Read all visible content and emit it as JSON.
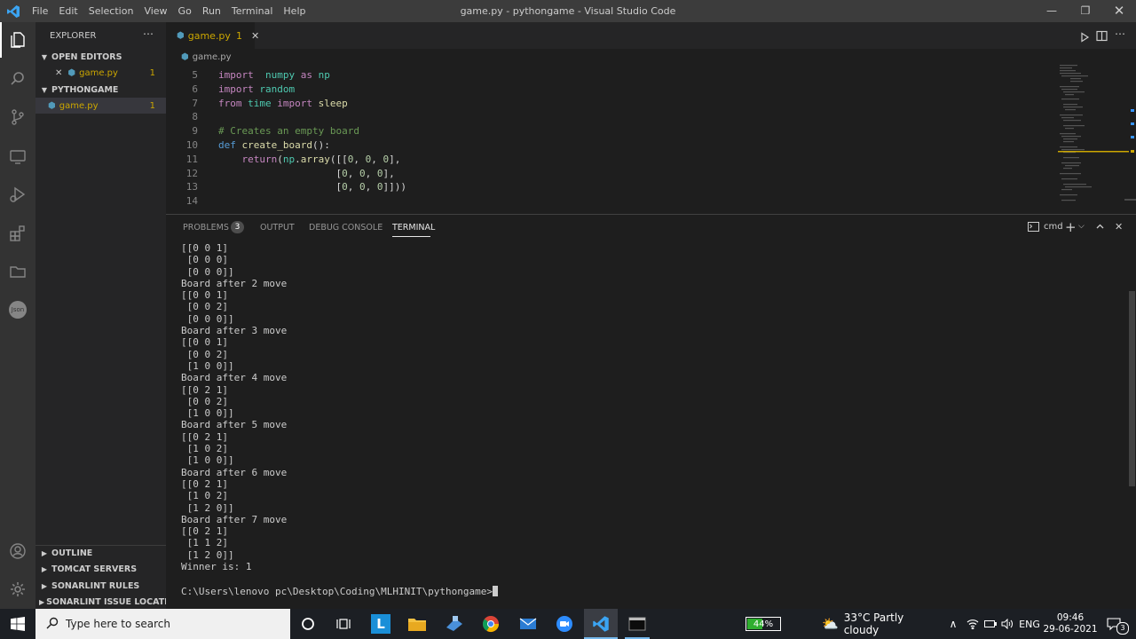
{
  "titlebar": {
    "menu": [
      "File",
      "Edit",
      "Selection",
      "View",
      "Go",
      "Run",
      "Terminal",
      "Help"
    ],
    "title": "game.py - pythongame - Visual Studio Code"
  },
  "sidebar": {
    "header": "EXPLORER",
    "open_editors": "OPEN EDITORS",
    "open_file": "game.py",
    "open_file_badge": "1",
    "project": "PYTHONGAME",
    "project_file": "game.py",
    "project_file_badge": "1",
    "bottom_sections": [
      "OUTLINE",
      "TOMCAT SERVERS",
      "SONARLINT RULES",
      "SONARLINT ISSUE LOCATIO..."
    ]
  },
  "editor": {
    "tab_label": "game.py",
    "tab_badge": "1",
    "breadcrumb": "game.py",
    "lines": [
      {
        "n": "5",
        "parts": [
          [
            "kw2",
            "import"
          ],
          [
            "",
            "  "
          ],
          [
            "mod",
            "numpy"
          ],
          [
            "",
            " "
          ],
          [
            "kw2",
            "as"
          ],
          [
            "",
            " "
          ],
          [
            "mod",
            "np"
          ]
        ]
      },
      {
        "n": "6",
        "parts": [
          [
            "kw2",
            "import"
          ],
          [
            "",
            " "
          ],
          [
            "mod",
            "random"
          ]
        ]
      },
      {
        "n": "7",
        "parts": [
          [
            "kw2",
            "from"
          ],
          [
            "",
            " "
          ],
          [
            "mod",
            "time"
          ],
          [
            "",
            " "
          ],
          [
            "kw2",
            "import"
          ],
          [
            "",
            " "
          ],
          [
            "fn",
            "sleep"
          ]
        ]
      },
      {
        "n": "8",
        "parts": []
      },
      {
        "n": "9",
        "parts": [
          [
            "cm",
            "# Creates an empty board"
          ]
        ]
      },
      {
        "n": "10",
        "parts": [
          [
            "kw",
            "def"
          ],
          [
            "",
            " "
          ],
          [
            "fn",
            "create_board"
          ],
          [
            "",
            "():"
          ]
        ]
      },
      {
        "n": "11",
        "parts": [
          [
            "",
            "    "
          ],
          [
            "kw2",
            "return"
          ],
          [
            "",
            "("
          ],
          [
            "mod",
            "np"
          ],
          [
            "",
            "."
          ],
          [
            "fn",
            "array"
          ],
          [
            "",
            "([["
          ],
          [
            "num",
            "0"
          ],
          [
            "",
            ", "
          ],
          [
            "num",
            "0"
          ],
          [
            "",
            ", "
          ],
          [
            "num",
            "0"
          ],
          [
            "",
            "],"
          ]
        ]
      },
      {
        "n": "12",
        "parts": [
          [
            "",
            "                    ["
          ],
          [
            "num",
            "0"
          ],
          [
            "",
            ", "
          ],
          [
            "num",
            "0"
          ],
          [
            "",
            ", "
          ],
          [
            "num",
            "0"
          ],
          [
            "",
            "],"
          ]
        ]
      },
      {
        "n": "13",
        "parts": [
          [
            "",
            "                    ["
          ],
          [
            "num",
            "0"
          ],
          [
            "",
            ", "
          ],
          [
            "num",
            "0"
          ],
          [
            "",
            ", "
          ],
          [
            "num",
            "0"
          ],
          [
            "",
            "]]))"
          ]
        ]
      },
      {
        "n": "14",
        "parts": []
      }
    ]
  },
  "panel": {
    "tabs": [
      "PROBLEMS",
      "OUTPUT",
      "DEBUG CONSOLE",
      "TERMINAL"
    ],
    "problems_count": "3",
    "terminal_name": "cmd",
    "terminal_lines": [
      "[[0 0 1]",
      " [0 0 0]",
      " [0 0 0]]",
      "Board after 2 move",
      "[[0 0 1]",
      " [0 0 2]",
      " [0 0 0]]",
      "Board after 3 move",
      "[[0 0 1]",
      " [0 0 2]",
      " [1 0 0]]",
      "Board after 4 move",
      "[[0 2 1]",
      " [0 0 2]",
      " [1 0 0]]",
      "Board after 5 move",
      "[[0 2 1]",
      " [1 0 2]",
      " [1 0 0]]",
      "Board after 6 move",
      "[[0 2 1]",
      " [1 0 2]",
      " [1 2 0]]",
      "Board after 7 move",
      "[[0 2 1]",
      " [1 1 2]",
      " [1 2 0]]",
      "Winner is: 1"
    ],
    "prompt": "C:\\Users\\lenovo pc\\Desktop\\Coding\\MLHINIT\\pythongame>"
  },
  "taskbar": {
    "search_placeholder": "Type here to search",
    "battery": "44%",
    "weather": "33°C  Partly cloudy",
    "language": "ENG",
    "time": "09:46",
    "date": "29-06-2021",
    "notification_count": "3"
  },
  "colors": {
    "accent": "#007acc",
    "warning": "#cca700",
    "python": "#519aba"
  }
}
